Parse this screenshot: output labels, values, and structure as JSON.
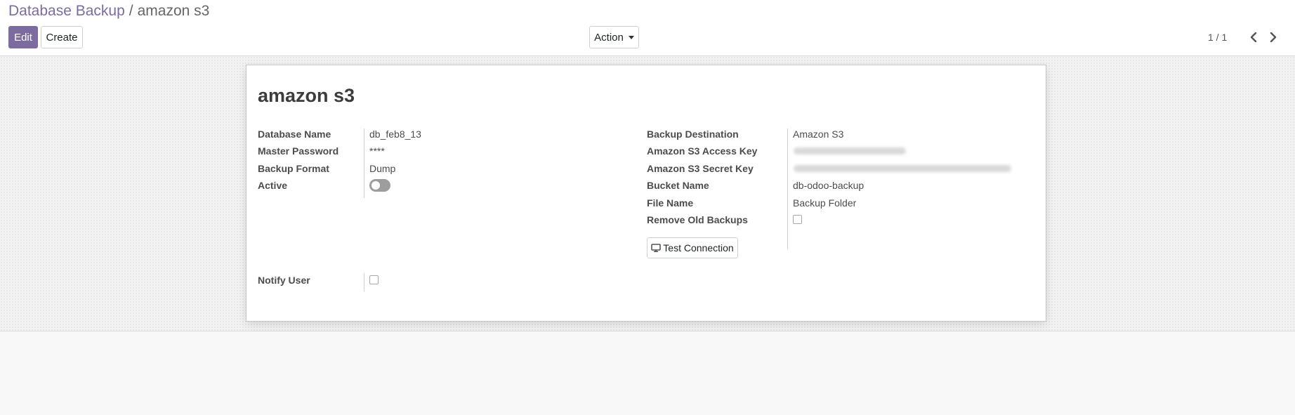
{
  "breadcrumb": {
    "parent": "Database Backup",
    "separator": "/",
    "current": "amazon s3"
  },
  "toolbar": {
    "edit_label": "Edit",
    "create_label": "Create",
    "action_label": "Action"
  },
  "pager": {
    "value": "1 / 1"
  },
  "record": {
    "title": "amazon s3"
  },
  "left_fields": {
    "database_name": {
      "label": "Database Name",
      "value": "db_feb8_13"
    },
    "master_password": {
      "label": "Master Password",
      "value": "****"
    },
    "backup_format": {
      "label": "Backup Format",
      "value": "Dump"
    },
    "active": {
      "label": "Active",
      "checked": false
    }
  },
  "right_fields": {
    "backup_destination": {
      "label": "Backup Destination",
      "value": "Amazon S3"
    },
    "access_key": {
      "label": "Amazon S3 Access Key"
    },
    "secret_key": {
      "label": "Amazon S3 Secret Key"
    },
    "bucket_name": {
      "label": "Bucket Name",
      "value": "db-odoo-backup"
    },
    "file_name": {
      "label": "File Name",
      "value": "Backup Folder"
    },
    "remove_old_backups": {
      "label": "Remove Old Backups",
      "checked": false
    }
  },
  "test_connection": {
    "label": "Test Connection",
    "icon": "monitor-icon"
  },
  "notify_user": {
    "label": "Notify User",
    "checked": false
  },
  "colors": {
    "brand": "#7c6b9e",
    "text": "#4c4c4c"
  }
}
